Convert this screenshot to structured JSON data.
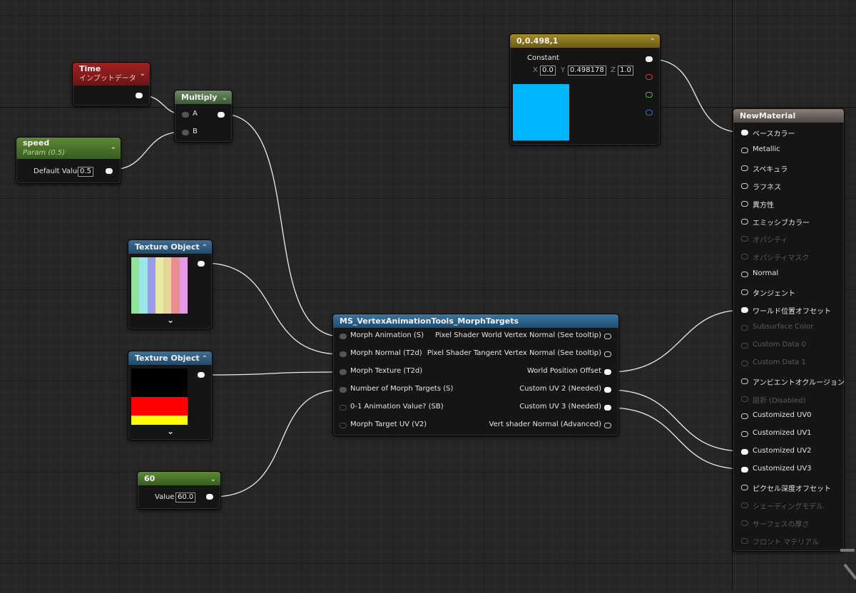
{
  "colors": {
    "accent_blue": "#00b6ff",
    "time_header": "#8e1d1d",
    "param_header": "#4a6a2a",
    "multiply_header": "#4f6a48",
    "texture_header": "#2e5b7e",
    "constant_header": "#8c7622",
    "function_header": "#2d5c80",
    "material_header": "#5e5650"
  },
  "time_node": {
    "title": "Time",
    "subtitle": "インプットデータ"
  },
  "multiply_node": {
    "title": "Multiply",
    "pin_a": "A",
    "pin_b": "B"
  },
  "speed_node": {
    "title": "speed",
    "subtitle": "Param (0.5)",
    "default_label": "Default Value",
    "default_value": "0.5"
  },
  "texture1": {
    "title": "Texture Object",
    "stripes": [
      "#8fe39a",
      "#9be6ea",
      "#9b9be9",
      "#eaeaa0",
      "#e9d39d",
      "#e88e8e",
      "#e39ae3"
    ]
  },
  "texture2": {
    "title": "Texture Object",
    "bands": [
      "#000000",
      "#ff0000",
      "#ffff00"
    ]
  },
  "const60": {
    "title": "60",
    "value_label": "Value",
    "value": "60.0"
  },
  "constant3": {
    "title": "0,0.498,1",
    "label": "Constant",
    "x_label": "X",
    "x_value": "0.0",
    "y_label": "Y",
    "y_value": "0.498178",
    "z_label": "Z",
    "z_value": "1.0"
  },
  "function_node": {
    "title": "MS_VertexAnimationTools_MorphTargets",
    "inputs": [
      "Morph Animation (S)",
      "Morph Normal (T2d)",
      "Morph Texture (T2d)",
      "Number of Morph Targets (S)",
      "0-1 Animation Value? (SB)",
      "Morph Target UV (V2)"
    ],
    "outputs": [
      "Pixel Shader World Vertex Normal (See tooltip)",
      "Pixel Shader Tangent Vertex Normal (See tooltip)",
      "World Position Offset",
      "Custom UV 2 (Needed)",
      "Custom UV 3 (Needed)",
      "Vert shader Normal (Advanced)"
    ]
  },
  "material_node": {
    "title": "NewMaterial",
    "pins": [
      {
        "label": "ベースカラー",
        "state": "on"
      },
      {
        "label": "Metallic",
        "state": "off"
      },
      {
        "label": "スペキュラ",
        "state": "off"
      },
      {
        "label": "ラフネス",
        "state": "off"
      },
      {
        "label": "異方性",
        "state": "off"
      },
      {
        "label": "エミッシブカラー",
        "state": "off"
      },
      {
        "label": "オパシティ",
        "state": "dis"
      },
      {
        "label": "オパシティマスク",
        "state": "dis"
      },
      {
        "label": "Normal",
        "state": "off"
      },
      {
        "label": "タンジェント",
        "state": "off"
      },
      {
        "label": "ワールド位置オフセット",
        "state": "on"
      },
      {
        "label": "Subsurface Color",
        "state": "dis"
      },
      {
        "label": "Custom Data 0",
        "state": "dis"
      },
      {
        "label": "Custom Data 1",
        "state": "dis"
      },
      {
        "label": "アンビエントオクルージョン",
        "state": "off"
      },
      {
        "label": "屈折 (Disabled)",
        "state": "dis"
      },
      {
        "label": "Customized UV0",
        "state": "off"
      },
      {
        "label": "Customized UV1",
        "state": "off"
      },
      {
        "label": "Customized UV2",
        "state": "on"
      },
      {
        "label": "Customized UV3",
        "state": "on"
      },
      {
        "label": "ピクセル深度オフセット",
        "state": "off"
      },
      {
        "label": "シェーディングモデル",
        "state": "dis"
      },
      {
        "label": "サーフェスの厚さ",
        "state": "dis"
      },
      {
        "label": "フロント マテリアル",
        "state": "dis"
      }
    ]
  }
}
